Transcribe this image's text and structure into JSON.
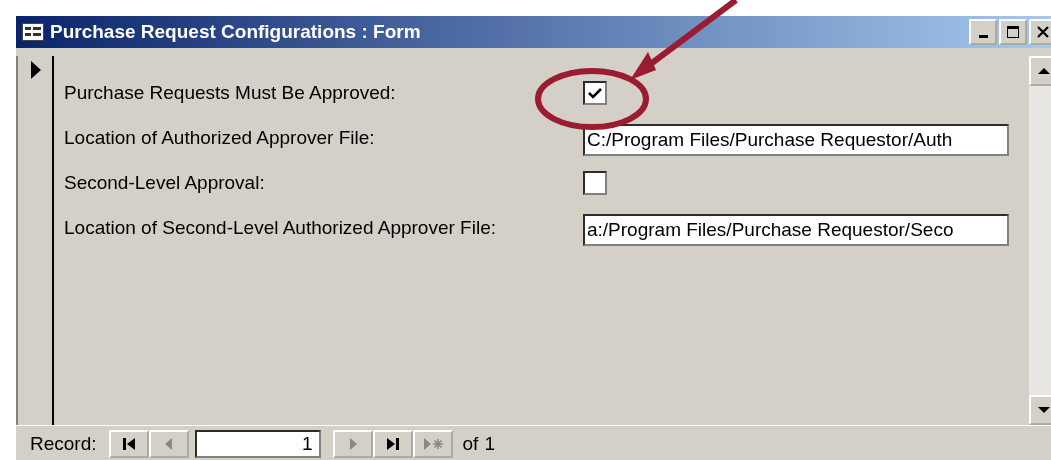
{
  "window": {
    "title": "Purchase Request Configurations : Form"
  },
  "fields": [
    {
      "kind": "checkbox",
      "label": "Purchase Requests Must Be Approved:",
      "checked": true
    },
    {
      "kind": "text",
      "label": "Location of Authorized Approver File:",
      "value": "C:/Program Files/Purchase Requestor/Auth"
    },
    {
      "kind": "checkbox",
      "label": "Second-Level Approval:",
      "checked": false
    },
    {
      "kind": "text",
      "label": "Location of Second-Level Authorized Approver File:",
      "value": "a:/Program Files/Purchase Requestor/Seco"
    }
  ],
  "navigation": {
    "label": "Record:",
    "current": "1",
    "of_label": "of",
    "total": "1"
  }
}
